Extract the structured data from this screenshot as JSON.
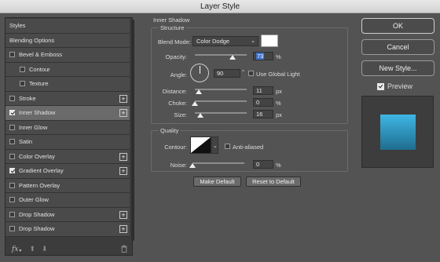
{
  "window": {
    "title": "Layer Style"
  },
  "left_panel": {
    "items": [
      {
        "label": "Styles",
        "type": "header"
      },
      {
        "label": "Blending Options",
        "type": "header"
      },
      {
        "label": "Bevel & Emboss",
        "checked": false,
        "plus": false
      },
      {
        "label": "Contour",
        "checked": false,
        "plus": false,
        "indent": true
      },
      {
        "label": "Texture",
        "checked": false,
        "plus": false,
        "indent": true
      },
      {
        "label": "Stroke",
        "checked": false,
        "plus": true
      },
      {
        "label": "Inner Shadow",
        "checked": true,
        "plus": true,
        "selected": true
      },
      {
        "label": "Inner Glow",
        "checked": false,
        "plus": false
      },
      {
        "label": "Satin",
        "checked": false,
        "plus": false
      },
      {
        "label": "Color Overlay",
        "checked": false,
        "plus": true
      },
      {
        "label": "Gradient Overlay",
        "checked": true,
        "plus": true
      },
      {
        "label": "Pattern Overlay",
        "checked": false,
        "plus": false
      },
      {
        "label": "Outer Glow",
        "checked": false,
        "plus": false
      },
      {
        "label": "Drop Shadow",
        "checked": false,
        "plus": true
      },
      {
        "label": "Drop Shadow",
        "checked": false,
        "plus": true
      }
    ],
    "footer": {
      "fx_label": "fx",
      "fx_arrow": "▾",
      "up_arrow": "⬆",
      "down_arrow": "⬇"
    }
  },
  "inner_shadow": {
    "title": "Inner Shadow",
    "structure_title": "Structure",
    "blend_mode_label": "Blend Mode:",
    "blend_mode_value": "Color Dodge",
    "blend_color": "#ffffff",
    "opacity_label": "Opacity:",
    "opacity_value": "73",
    "opacity_unit": "%",
    "angle_label": "Angle:",
    "angle_value": "90",
    "angle_unit": "°",
    "use_global_light_label": "Use Global Light",
    "use_global_light": false,
    "distance_label": "Distance:",
    "distance_value": "11",
    "distance_unit": "px",
    "choke_label": "Choke:",
    "choke_value": "0",
    "choke_unit": "%",
    "size_label": "Size:",
    "size_value": "16",
    "size_unit": "px",
    "quality_title": "Quality",
    "contour_label": "Contour:",
    "anti_aliased_label": "Anti-aliased",
    "anti_aliased": false,
    "noise_label": "Noise:",
    "noise_value": "0",
    "noise_unit": "%",
    "make_default_label": "Make Default",
    "reset_default_label": "Reset to Default"
  },
  "right_panel": {
    "ok_label": "OK",
    "cancel_label": "Cancel",
    "new_style_label": "New Style...",
    "preview_label": "Preview",
    "preview_checked": true,
    "preview_swatch_top": "#3fb6e4",
    "preview_swatch_bottom": "#1f6d8e"
  },
  "colors": {
    "panel_bg": "#535353",
    "selected_row": "#6a6a6a",
    "highlight": "#3d6fc7"
  }
}
